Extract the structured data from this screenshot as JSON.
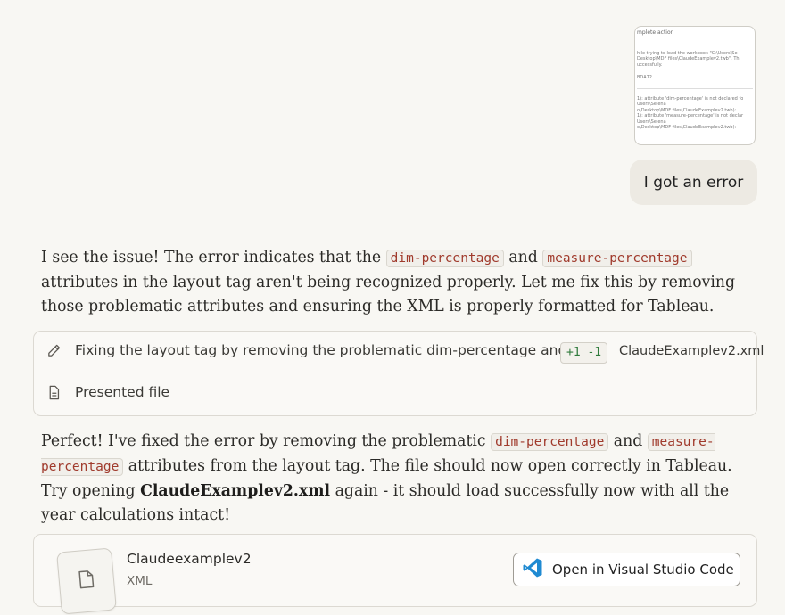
{
  "attachment": {
    "lines": [
      "mplete action",
      "",
      "hile trying to load the workbook \"C:\\Users\\Se",
      "Desktop\\MDF files\\ClaudeExamplev2.twb\". Th",
      "uccessfully.",
      "",
      "BDA72",
      "---",
      "1): attribute 'dim-percentage' is not declared fo",
      "Users\\Selena",
      "o\\Desktop\\MDF files\\ClaudeExamplev2.twb):",
      "1): attribute 'measure-percentage' is not declar",
      "Users\\Selena",
      "o\\Desktop\\MDF files\\ClaudeExamplev2.twb):"
    ]
  },
  "user_message": "I got an error",
  "assistant_1": {
    "t1": "I see the issue! The error indicates that the ",
    "code1": "dim-percentage",
    "t2": " and ",
    "code2": "measure-percentage",
    "t3": " attributes in the layout tag aren't being recognized properly. Let me fix this by removing those problematic attributes and ensuring the XML is properly formatted for Tableau."
  },
  "tool_card": {
    "edit_text": "Fixing the layout tag by removing the problematic dim-percentage and",
    "diff_stat": "+1 -1",
    "file_ref": "ClaudeExamplev2.xml",
    "present_text": "Presented file",
    "edit_icon": "pencil-icon",
    "present_icon": "document-icon"
  },
  "assistant_2": {
    "t1": "Perfect! I've fixed the error by removing the problematic ",
    "code1": "dim-percentage",
    "t2": " and ",
    "code2": "measure-percentage",
    "t3": " attributes from the layout tag. The file should now open correctly in Tableau. Try opening ",
    "bold": "ClaudeExamplev2.xml",
    "t4": " again - it should load successfully now with all the year calculations intact!"
  },
  "artifact": {
    "name": "Claudeexamplev2",
    "type": "XML",
    "open_button": "Open in Visual Studio Code",
    "icon": "file-icon",
    "button_icon": "vscode-icon"
  },
  "colors": {
    "background": "#f8f7f3",
    "code_text": "#a03a2c",
    "diff_add": "#2f7a3b",
    "vscode_blue": "#1f8ad2"
  }
}
